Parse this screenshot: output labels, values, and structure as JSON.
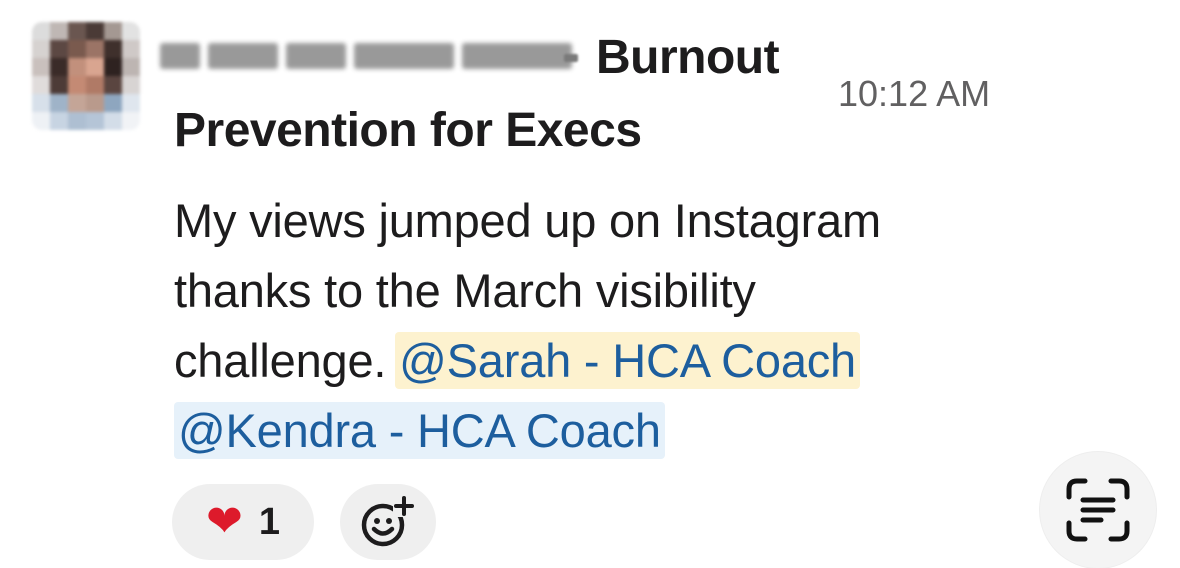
{
  "message": {
    "channel_name_line1": "Burnout",
    "channel_name_line2": "Prevention for Execs",
    "timestamp": "10:12 AM",
    "text_line1": "My views jumped up on Instagram",
    "text_line2": "thanks to the March visibility",
    "text_line3": "challenge.",
    "mention_1": "@Sarah - HCA Coach",
    "mention_2": "@Kendra - HCA Coach",
    "mention_colors": {
      "text": "#1d5e9e",
      "highlight_1": "#fdf2cf",
      "highlight_2": "#e6f1fa"
    }
  },
  "reactions": [
    {
      "icon": "red-heart-icon",
      "glyph": "❤",
      "count": "1"
    }
  ],
  "add_reaction": {
    "icon": "add-emoji-icon"
  },
  "scan_button": {
    "icon": "live-text-scan-icon"
  }
}
